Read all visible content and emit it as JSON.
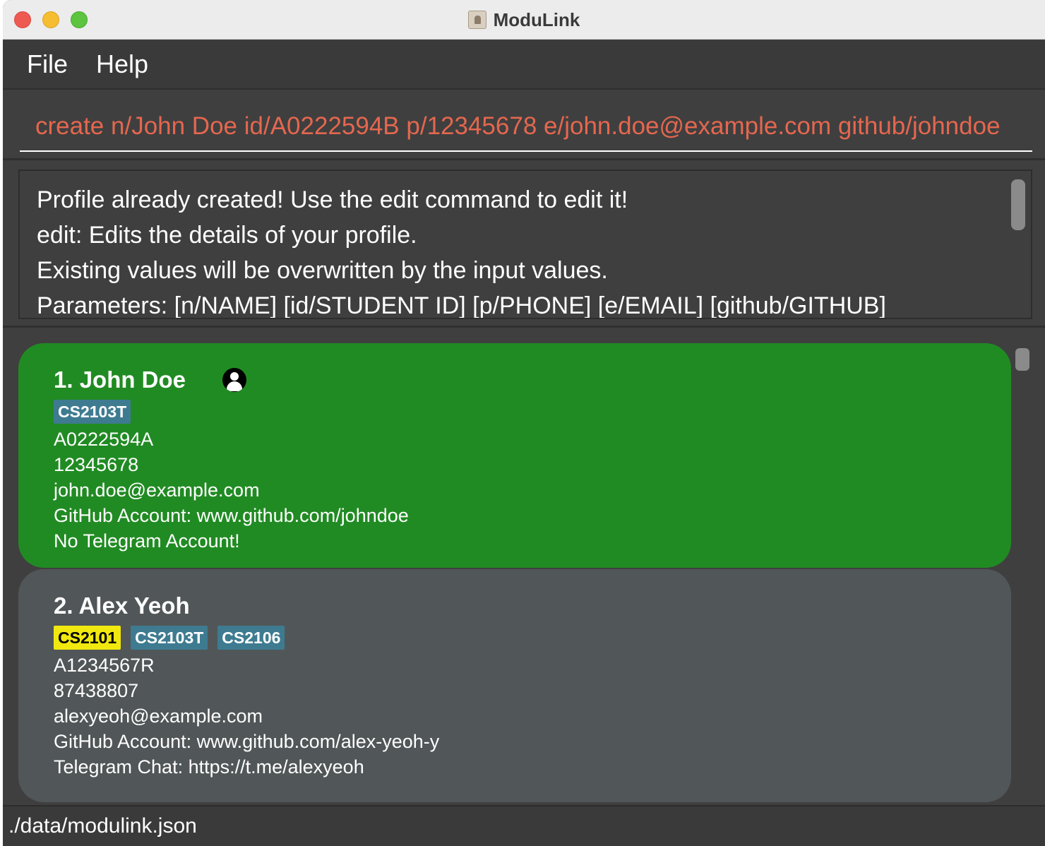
{
  "window": {
    "title": "ModuLink"
  },
  "menu": {
    "items": [
      "File",
      "Help"
    ]
  },
  "command": {
    "value": "create n/John Doe id/A0222594B p/12345678 e/john.doe@example.com    github/johndoe"
  },
  "result": {
    "lines": [
      "Profile already created! Use the edit command to edit it!",
      "edit: Edits the details of your profile.",
      "Existing values will be overwritten by the input values.",
      "Parameters: [n/NAME] [id/STUDENT ID] [p/PHONE] [e/EMAIL] [github/GITHUB]"
    ]
  },
  "persons": [
    {
      "name": "1. John Doe",
      "tags": [
        "CS2103T"
      ],
      "student_id": "A0222594A",
      "phone": "12345678",
      "email": "john.doe@example.com",
      "github": "GitHub Account: www.github.com/johndoe",
      "telegram": "No Telegram Account!"
    },
    {
      "name": "2. Alex Yeoh",
      "tags": [
        "CS2101",
        "CS2103T",
        "CS2106"
      ],
      "student_id": "A1234567R",
      "phone": "87438807",
      "email": "alexyeoh@example.com",
      "github": "GitHub Account: www.github.com/alex-yeoh-y",
      "telegram": "Telegram Chat: https://t.me/alexyeoh"
    }
  ],
  "status": {
    "file_path": "./data/modulink.json"
  },
  "colors": {
    "self_card": "#218b23",
    "card": "#515658",
    "tag": "#3e7b91",
    "tag_highlight": "#f0e80f",
    "command_text": "#e5674f"
  }
}
